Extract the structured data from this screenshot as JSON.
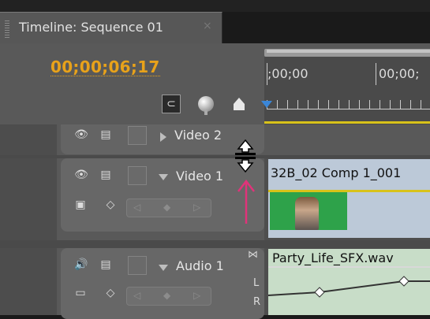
{
  "window": {
    "tab_title": "Timeline: Sequence 01",
    "close_glyph": "×"
  },
  "timecode": "00;00;06;17",
  "ruler": {
    "labels": [
      ";00;00",
      "00;00;"
    ]
  },
  "tools": {
    "snap_icon": "snap-magnet-icon",
    "marker_icon": "set-marker-icon",
    "keyframe_icon": "keyframe-icon"
  },
  "tracks": {
    "video2": {
      "name": "Video 2",
      "expanded": false
    },
    "video1": {
      "name": "Video 1",
      "expanded": true,
      "clip_name": "32B_02 Comp 1_001"
    },
    "audio1": {
      "name": "Audio 1",
      "expanded": true,
      "clip_name": "Party_Life_SFX.wav",
      "channel_left": "L",
      "channel_right": "R"
    }
  },
  "glyphs": {
    "eye": "👁",
    "film": "▤",
    "speaker": "🔊",
    "nav_prev": "◁",
    "nav_key": "◆",
    "nav_next": "▷",
    "bowtie": "⋈"
  },
  "colors": {
    "timecode": "#e8a21a",
    "playhead": "#3a86d8",
    "video_clip": "#bcc9d8",
    "audio_clip": "#c8ddc8",
    "work_area": "#d8c21a",
    "annotation_arrow": "#e0337a"
  }
}
